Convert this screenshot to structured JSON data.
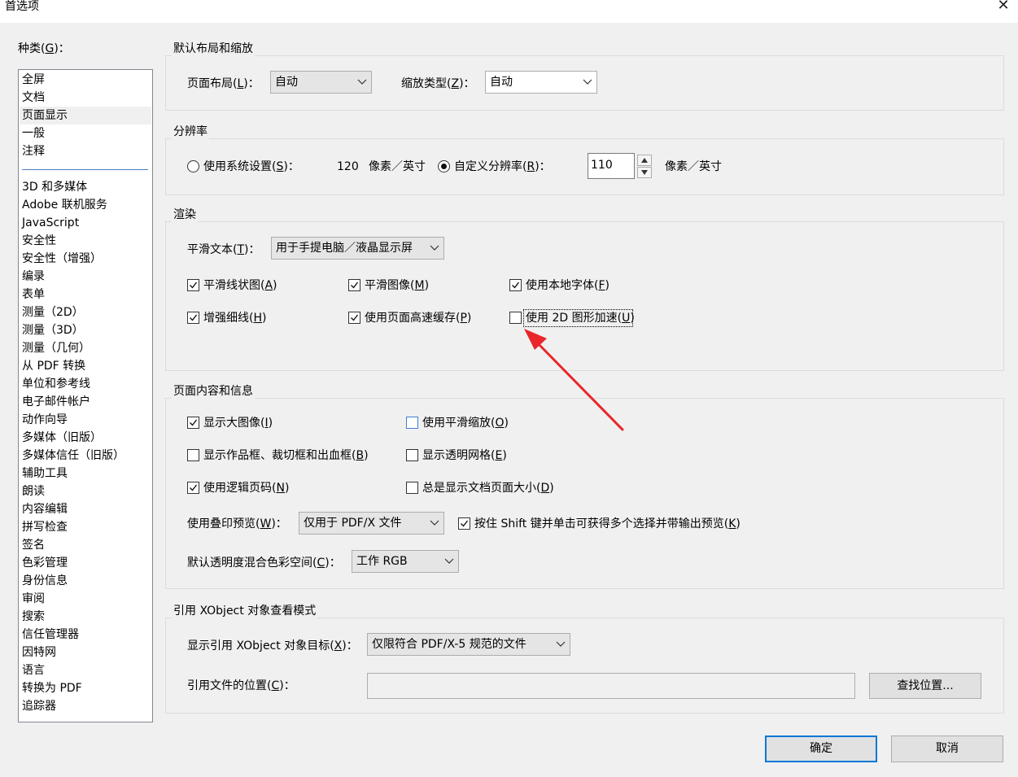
{
  "window": {
    "title": "首选项",
    "close_glyph": "✕"
  },
  "category": {
    "label": "种类",
    "mnemonic": "G",
    "items": [
      "全屏",
      "文档",
      "页面显示",
      "一般",
      "注释",
      "3D 和多媒体",
      "Adobe 联机服务",
      "JavaScript",
      "安全性",
      "安全性（增强）",
      "编录",
      "表单",
      "测量（2D）",
      "测量（3D）",
      "测量（几何）",
      "从 PDF 转换",
      "单位和参考线",
      "电子邮件帐户",
      "动作向导",
      "多媒体（旧版）",
      "多媒体信任（旧版）",
      "辅助工具",
      "朗读",
      "内容编辑",
      "拼写检查",
      "签名",
      "色彩管理",
      "身份信息",
      "审阅",
      "搜索",
      "信任管理器",
      "因特网",
      "语言",
      "转换为 PDF",
      "追踪器"
    ],
    "selected": "页面显示"
  },
  "default_layout": {
    "title": "默认布局和缩放",
    "page_layout_label": "页面布局",
    "page_layout_key": "L",
    "page_layout_value": "自动",
    "zoom_label": "缩放类型",
    "zoom_key": "Z",
    "zoom_value": "自动"
  },
  "resolution": {
    "title": "分辨率",
    "system_label": "使用系统设置",
    "system_key": "S",
    "system_value": "120",
    "system_unit": "像素／英寸",
    "custom_label": "自定义分辨率",
    "custom_key": "R",
    "custom_value": "110",
    "custom_unit": "像素／英寸",
    "selected": "custom"
  },
  "rendering": {
    "title": "渲染",
    "smooth_text_label": "平滑文本",
    "smooth_text_key": "T",
    "smooth_text_value": "用于手提电脑／液晶显示屏",
    "checks": [
      {
        "label": "平滑线状图",
        "key": "A",
        "checked": true
      },
      {
        "label": "平滑图像",
        "key": "M",
        "checked": true
      },
      {
        "label": "使用本地字体",
        "key": "F",
        "checked": true
      },
      {
        "label": "增强细线",
        "key": "H",
        "checked": true
      },
      {
        "label": "使用页面高速缓存",
        "key": "P",
        "checked": true
      },
      {
        "label": "使用 2D 图形加速",
        "key": "U",
        "checked": false
      }
    ]
  },
  "page_content": {
    "title": "页面内容和信息",
    "checks": [
      {
        "label": "显示大图像",
        "key": "I",
        "checked": true
      },
      {
        "label": "使用平滑缩放",
        "key": "O",
        "checked": false
      },
      {
        "label": "显示作品框、裁切框和出血框",
        "key": "B",
        "checked": false
      },
      {
        "label": "显示透明网格",
        "key": "E",
        "checked": false
      },
      {
        "label": "使用逻辑页码",
        "key": "N",
        "checked": true
      },
      {
        "label": "总是显示文档页面大小",
        "key": "D",
        "checked": false
      }
    ],
    "overprint_label": "使用叠印预览",
    "overprint_key": "W",
    "overprint_value": "仅用于 PDF/X 文件",
    "shift_label": "按住 Shift 键并单击可获得多个选择并带输出预览",
    "shift_key": "K",
    "shift_checked": true,
    "blend_label": "默认透明度混合色彩空间",
    "blend_key": "C",
    "blend_value": "工作 RGB"
  },
  "xobject": {
    "title": "引用 XObject 对象查看模式",
    "target_label": "显示引用 XObject 对象目标",
    "target_key": "X",
    "target_value": "仅限符合 PDF/X-5 规范的文件",
    "location_label": "引用文件的位置",
    "location_key": "C",
    "location_value": "",
    "find_button": "查找位置..."
  },
  "footer": {
    "ok": "确定",
    "cancel": "取消"
  },
  "colors": {
    "annotation_arrow": "#e8262b",
    "focus": "#0078d7"
  }
}
